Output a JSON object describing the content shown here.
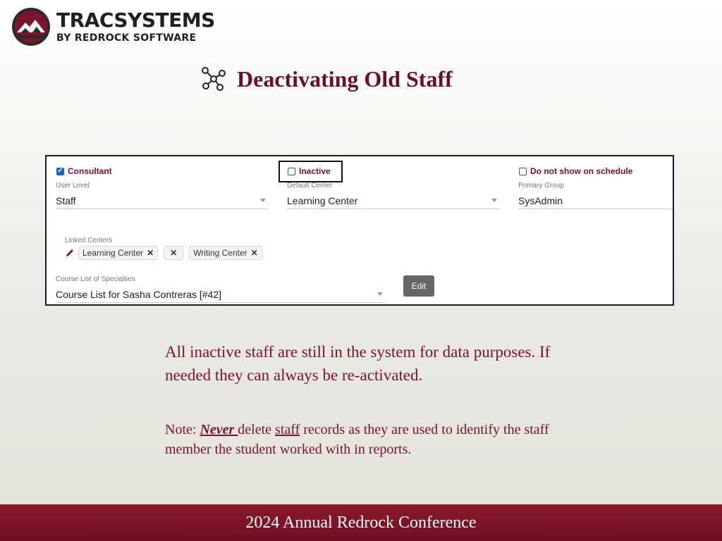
{
  "logo": {
    "main": "TRACSYSTEMS",
    "sub": "BY REDROCK SOFTWARE"
  },
  "slide": {
    "title": "Deactivating Old Staff"
  },
  "panel": {
    "checkboxes": [
      {
        "label": "Consultant",
        "checked": true
      },
      {
        "label": "Inactive",
        "checked": false
      },
      {
        "label": "Do not show on schedule",
        "checked": false
      }
    ],
    "user_level": {
      "label": "User Level",
      "value": "Staff"
    },
    "default_center": {
      "label": "Default Center",
      "value": "Learning Center"
    },
    "primary_group": {
      "label": "Primary Group",
      "value": "SysAdmin"
    },
    "linked_centers": {
      "label": "Linked Centers",
      "chips": [
        "Learning Center",
        "",
        "Writing Center"
      ]
    },
    "course_list": {
      "label": "Course List of Specialties",
      "value": "Course List for Sasha Contreras [#42]"
    },
    "edit_label": "Edit"
  },
  "text": {
    "body1": "All inactive staff are still in the system for data purposes. If needed they can always be re-activated.",
    "note_prefix": "Note: ",
    "note_never": "Never ",
    "note_mid": "delete ",
    "note_staff": "staff",
    "note_rest": " records as they are used to identify the staff member the student worked with in reports."
  },
  "footer": {
    "text": "2024 Annual Redrock Conference"
  },
  "colors": {
    "accent": "#6b0f23",
    "footer_bg": "#7a1428",
    "checkbox_on": "#1565c0"
  }
}
